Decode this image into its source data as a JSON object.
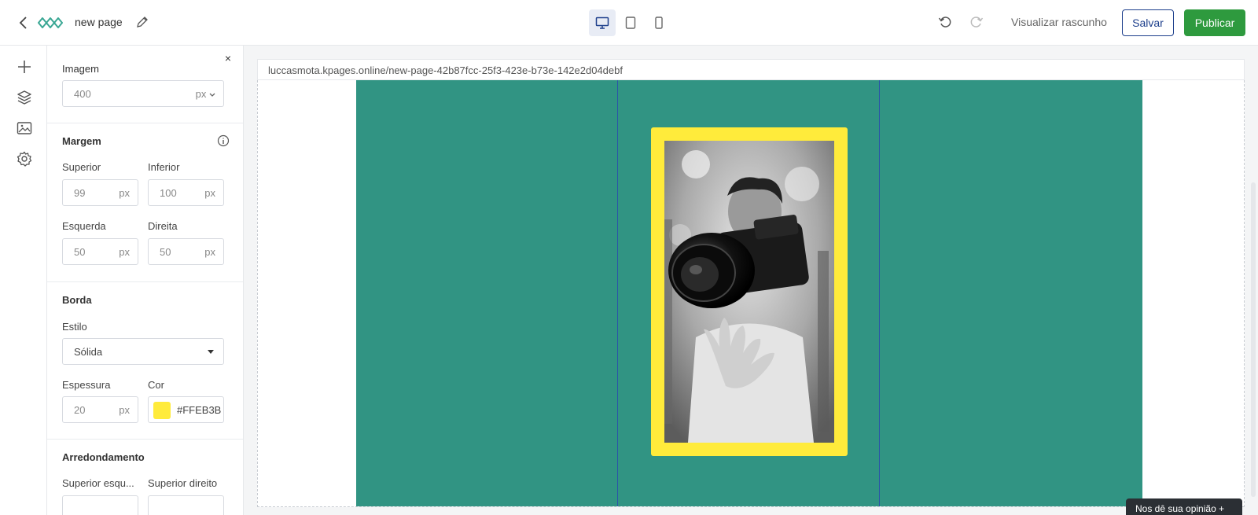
{
  "app": {
    "page_name": "new page"
  },
  "toolbar": {
    "preview_label": "Visualizar rascunho",
    "save_label": "Salvar",
    "publish_label": "Publicar",
    "active_device": "desktop"
  },
  "panel": {
    "title": "Imagem",
    "close_glyph": "×",
    "top_field": {
      "value": "400",
      "unit": "px"
    },
    "margin": {
      "title": "Margem",
      "top_label": "Superior",
      "top_value": "99",
      "top_unit": "px",
      "bottom_label": "Inferior",
      "bottom_value": "100",
      "bottom_unit": "px",
      "left_label": "Esquerda",
      "left_value": "50",
      "left_unit": "px",
      "right_label": "Direita",
      "right_value": "50",
      "right_unit": "px"
    },
    "border": {
      "title": "Borda",
      "style_label": "Estilo",
      "style_value": "Sólida",
      "width_label": "Espessura",
      "width_value": "20",
      "width_unit": "px",
      "color_label": "Cor",
      "color_value": "#FFEB3B"
    },
    "rounding": {
      "title": "Arredondamento",
      "top_left_label": "Superior esqu...",
      "top_right_label": "Superior direito"
    }
  },
  "canvas": {
    "url": "luccasmota.kpages.online/new-page-42b87fcc-25f3-423e-b73e-142e2d04debf",
    "section_color": "#319483",
    "border_color": "#FFEB3B",
    "column_line_color": "#2a55a8"
  },
  "feedback_label": "Nos dê sua opinião  +",
  "colors": {
    "accent": "#1d3f8c",
    "publish": "#2e9a3e"
  }
}
